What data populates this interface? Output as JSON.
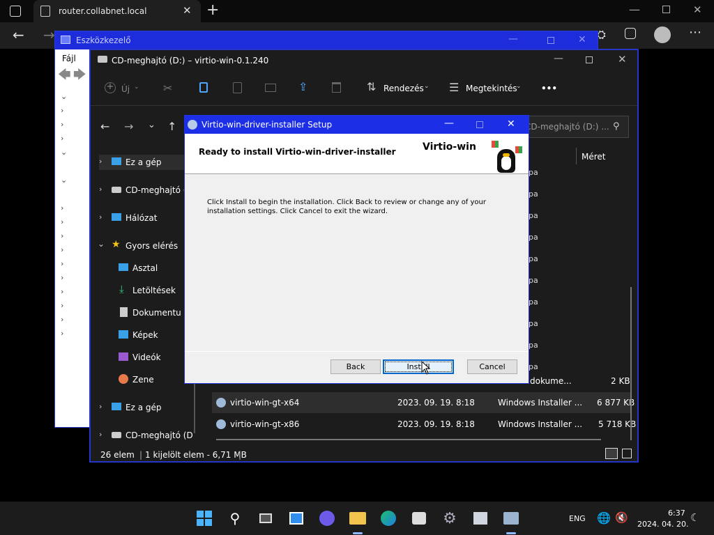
{
  "browser": {
    "tab_title": "router.collabnet.local"
  },
  "devmgr": {
    "title": "Eszközkezelő",
    "menu_file": "Fájl"
  },
  "explorer": {
    "title": "CD-meghajtó (D:) – virtio-win-0.1.240",
    "new_label": "Új",
    "sort_label": "Rendezés",
    "view_label": "Megtekintés",
    "more_label": "•••",
    "search_placeholder": "CD-meghajtó (D:) ...",
    "col_size": "Méret",
    "nav": [
      "Ez a gép",
      "CD-meghajtó (D",
      "Hálózat",
      "Gyors elérés",
      "Asztal",
      "Letöltések",
      "Dokumentu",
      "Képek",
      "Videók",
      "Zene",
      "Ez a gép",
      "CD-meghajtó (D"
    ],
    "partial_type": "pa",
    "partial_row": {
      "type": "dokume...",
      "size": "2 KB"
    },
    "files": [
      {
        "name": "virtio-win-gt-x64",
        "date": "2023. 09. 19. 8:18",
        "type": "Windows Installer ...",
        "size": "6 877 KB"
      },
      {
        "name": "virtio-win-gt-x86",
        "date": "2023. 09. 19. 8:18",
        "type": "Windows Installer ...",
        "size": "5 718 KB"
      }
    ],
    "status_count": "26 elem",
    "status_selected": "1 kijelölt elem - 6,71 MB"
  },
  "setup": {
    "title": "Virtio-win-driver-installer Setup",
    "heading": "Ready to install Virtio-win-driver-installer",
    "brand": "Virtio-win",
    "body_line1": "Click Install to begin the installation. Click Back to review or change any of your",
    "body_line2": "installation settings. Click Cancel to exit the wizard.",
    "back_label": "Back",
    "install_label": "Install",
    "cancel_label": "Cancel"
  },
  "taskbar": {
    "lang": "ENG",
    "time": "6:37",
    "date": "2024. 04. 20."
  },
  "colors": {
    "accent_blue": "#1d2fe6",
    "taskbar_bg": "#1c1c1c",
    "explorer_bg": "#1c1c1c"
  }
}
